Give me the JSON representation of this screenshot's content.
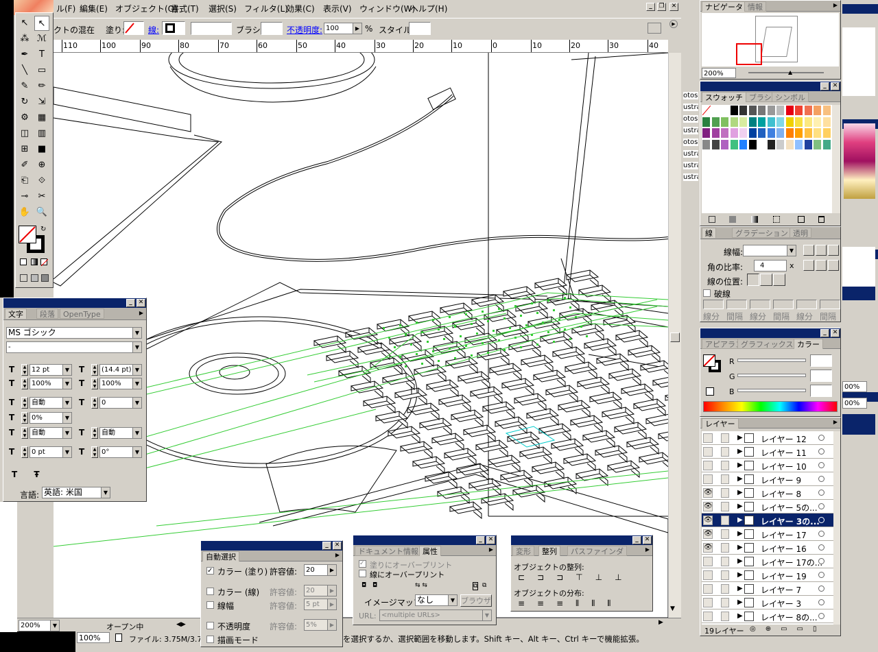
{
  "menu": [
    "ル(F)",
    "編集(E)",
    "オブジェクト(O)",
    "書式(T)",
    "選択(S)",
    "フィルタ(L)",
    "効果(C)",
    "表示(V)",
    "ウィンドウ(W)",
    "ヘルプ(H)"
  ],
  "control": {
    "blend_label": "クトの混在",
    "fill_label": "塗り:",
    "stroke_label": "線:",
    "brush_label": "ブラシ:",
    "opacity_label": "不透明度:",
    "opacity_value": "100",
    "percent": "%",
    "style_label": "スタイル:"
  },
  "ruler_h": [
    "110",
    "100",
    "90",
    "80",
    "70",
    "60",
    "50",
    "40",
    "30",
    "20",
    "10",
    "0",
    "10",
    "20",
    "30",
    "40"
  ],
  "status": {
    "zoom": "200%",
    "open_label": "オープン中",
    "zoom2": "100%",
    "file": "ファイル: 3.75M/3.75M",
    "hint": "を選択するか、選択範囲を移動します。Shift キー、Alt キー、Ctrl キーで機能拡張。"
  },
  "navigator": {
    "tabs": [
      "ナビゲータ",
      "情報"
    ],
    "zoom": "200%"
  },
  "swatches": {
    "tabs": [
      "スウォッチ",
      "ブラシ",
      "シンボル"
    ]
  },
  "stroke": {
    "tabs": [
      "線",
      "グラデーション",
      "透明"
    ],
    "weight_label": "線幅:",
    "miter_label": "角の比率:",
    "miter_value": "4",
    "x": "x",
    "align_label": "線の位置:",
    "dashed_label": "破線",
    "dash_labels": [
      "線分",
      "間隔",
      "線分",
      "間隔",
      "線分",
      "間隔"
    ]
  },
  "color": {
    "tabs": [
      "アピアラン",
      "グラフィックスタイ",
      "カラー"
    ],
    "r": "R",
    "g": "G",
    "b": "B"
  },
  "layers": {
    "tab": "レイヤー",
    "count": "19レイヤー",
    "items": [
      {
        "name": "レイヤー 12",
        "visible": false,
        "selected": false
      },
      {
        "name": "レイヤー 11",
        "visible": false,
        "selected": false
      },
      {
        "name": "レイヤー 10",
        "visible": false,
        "selected": false
      },
      {
        "name": "レイヤー 9",
        "visible": false,
        "selected": false
      },
      {
        "name": "レイヤー 8",
        "visible": true,
        "selected": false
      },
      {
        "name": "レイヤー 5の...",
        "visible": true,
        "selected": false
      },
      {
        "name": "レイヤー 3の...",
        "visible": true,
        "selected": true
      },
      {
        "name": "レイヤー 17",
        "visible": true,
        "selected": false
      },
      {
        "name": "レイヤー 16",
        "visible": true,
        "selected": false
      },
      {
        "name": "レイヤー 17の...",
        "visible": false,
        "selected": false
      },
      {
        "name": "レイヤー 19",
        "visible": false,
        "selected": false
      },
      {
        "name": "レイヤー 7",
        "visible": false,
        "selected": false
      },
      {
        "name": "レイヤー 3",
        "visible": false,
        "selected": false
      },
      {
        "name": "レイヤー 8の...",
        "visible": false,
        "selected": false
      }
    ]
  },
  "character": {
    "tabs": [
      "文字",
      "段落",
      "OpenType"
    ],
    "font": "MS ゴシック",
    "style": "-",
    "size": "12 pt",
    "leading": "(14.4 pt)",
    "vscale": "100%",
    "hscale": "100%",
    "kerning": "自動",
    "tracking": "0",
    "tsume": "0%",
    "aki_left": "自動",
    "aki_right": "自動",
    "baseline": "0 pt",
    "rotation": "0°",
    "lang_label": "言語:",
    "lang": "英語: 米国"
  },
  "magic_wand": {
    "tab": "自動選択",
    "rows": [
      {
        "label": "カラー (塗り)",
        "tol_label": "許容値:",
        "value": "20",
        "checked": true
      },
      {
        "label": "カラー (線)",
        "tol_label": "許容値:",
        "value": "20",
        "checked": false
      },
      {
        "label": "線幅",
        "tol_label": "許容値:",
        "value": "5 pt",
        "checked": false
      },
      {
        "label": "不透明度",
        "tol_label": "許容値:",
        "value": "5%",
        "checked": false
      },
      {
        "label": "描画モード",
        "tol_label": "",
        "value": "",
        "checked": false
      }
    ]
  },
  "attributes": {
    "tabs": [
      "ドキュメント情報",
      "属性"
    ],
    "overprint_fill": "塗りにオーバープリント",
    "overprint_stroke": "線にオーバープリント",
    "imagemap_label": "イメージマップ:",
    "imagemap_value": "なし",
    "browser": "ブラウザ",
    "url_label": "URL:",
    "url_value": "<multiple URLs>"
  },
  "align": {
    "tabs": [
      "変形",
      "整列",
      "パスファインダ"
    ],
    "align_label": "オブジェクトの整列:",
    "dist_label": "オブジェクトの分布:"
  },
  "side_labels": [
    "otos",
    "ustra",
    "otos",
    "ustra",
    "otos",
    "ustra",
    "ustra",
    "ustra"
  ],
  "far_right": {
    "pct1": "00%",
    "pct2": "00%"
  }
}
